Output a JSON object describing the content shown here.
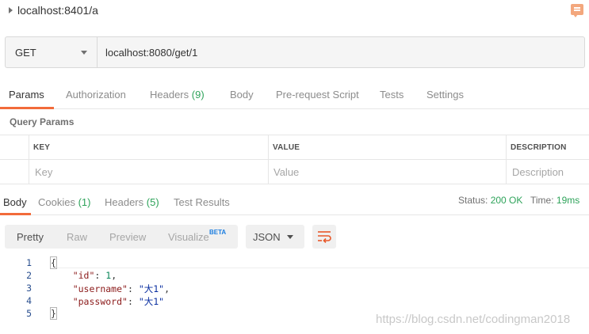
{
  "request": {
    "name": "localhost:8401/a",
    "method": "GET",
    "url": "localhost:8080/get/1"
  },
  "icons": {
    "collapse": "caret-right-icon",
    "comments": "comment-icon",
    "method_dropdown": "chevron-down-icon",
    "format_dropdown": "chevron-down-icon",
    "wrap": "wrap-lines-icon"
  },
  "request_tabs": [
    {
      "label": "Params",
      "count": ""
    },
    {
      "label": "Authorization",
      "count": ""
    },
    {
      "label": "Headers",
      "count": "(9)"
    },
    {
      "label": "Body",
      "count": ""
    },
    {
      "label": "Pre-request Script",
      "count": ""
    },
    {
      "label": "Tests",
      "count": ""
    },
    {
      "label": "Settings",
      "count": ""
    }
  ],
  "query_params": {
    "title": "Query Params",
    "columns": [
      "KEY",
      "VALUE",
      "DESCRIPTION"
    ],
    "placeholders": [
      "Key",
      "Value",
      "Description"
    ]
  },
  "response_tabs": [
    {
      "label": "Body",
      "count": ""
    },
    {
      "label": "Cookies",
      "count": "(1)"
    },
    {
      "label": "Headers",
      "count": "(5)"
    },
    {
      "label": "Test Results",
      "count": ""
    }
  ],
  "status": {
    "status_label": "Status:",
    "status_value": "200 OK",
    "time_label": "Time:",
    "time_value": "19ms"
  },
  "view_modes": {
    "pretty": "Pretty",
    "raw": "Raw",
    "preview": "Preview",
    "visualize": "Visualize",
    "beta": "BETA"
  },
  "format": "JSON",
  "code_lines": {
    "n1": "1",
    "n2": "2",
    "n3": "3",
    "n4": "4",
    "n5": "5",
    "open_brace": "{",
    "close_brace": "}",
    "id_key": "\"id\"",
    "id_val": "1",
    "username_key": "\"username\"",
    "username_val": "\"大1\"",
    "password_key": "\"password\"",
    "password_val": "\"大1\""
  },
  "watermark": "https://blog.csdn.net/codingman2018",
  "colors": {
    "accent": "#f26b3a",
    "count_green": "#2ea35a",
    "beta_blue": "#1c7ee0"
  }
}
